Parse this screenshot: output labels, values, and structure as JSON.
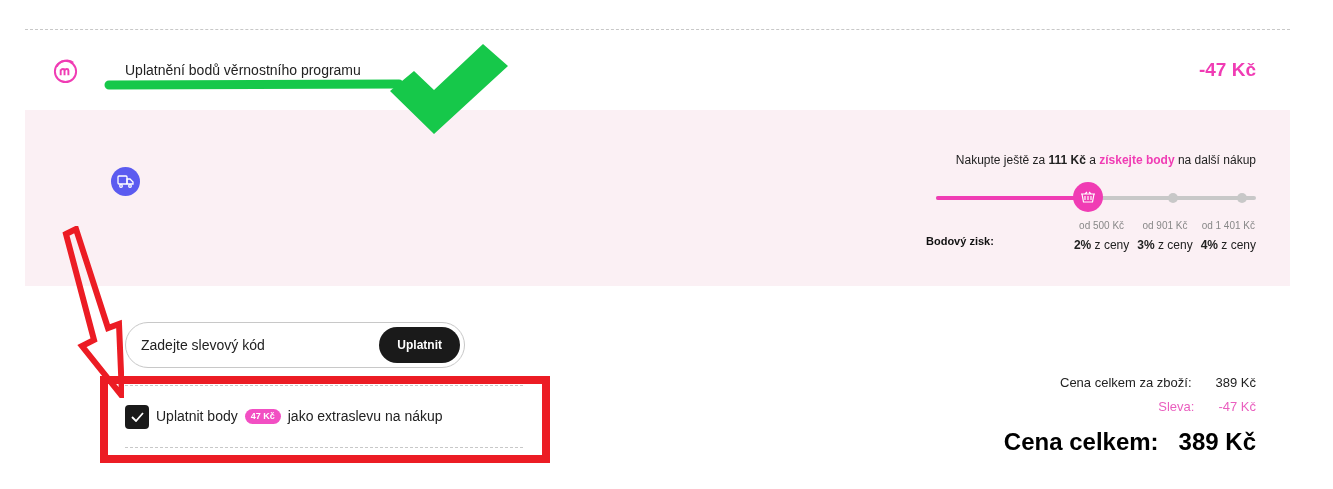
{
  "loyalty": {
    "title": "Uplatnění bodů věrnostního programu",
    "amount": "-47 Kč"
  },
  "points_panel": {
    "message": [
      {
        "text": "Nakupte ještě za ",
        "kind": "plain"
      },
      {
        "text": "111 Kč",
        "kind": "bold"
      },
      {
        "text": " a ",
        "kind": "plain"
      },
      {
        "text": "získejte body",
        "kind": "highlight"
      },
      {
        "text": " na další nákup",
        "kind": "plain"
      }
    ],
    "level": 0.475,
    "gain_label": "Bodový zisk:",
    "tiers": [
      {
        "threshold": "od 500 Kč",
        "rate": "**2%** z ceny"
      },
      {
        "threshold": "od 901 Kč",
        "rate": "**3%** z ceny"
      },
      {
        "threshold": "od 1 401 Kč",
        "rate": "**4%** z ceny"
      }
    ]
  },
  "coupon": {
    "placeholder": "Zadejte slevový kód",
    "button": "Uplatnit"
  },
  "points_option": {
    "checked": true,
    "label_before": "Uplatnit body",
    "badge": "47 Kč",
    "label_after": "jako extraslevu na nákup"
  },
  "summary": [
    {
      "label": "Cena celkem za zboží:",
      "value": "389 Kč",
      "kind": "subtotal"
    },
    {
      "label": "Sleva:",
      "value": "-47 Kč",
      "kind": "discount"
    },
    {
      "label": "Cena celkem:",
      "value": "389 Kč",
      "kind": "total"
    }
  ]
}
